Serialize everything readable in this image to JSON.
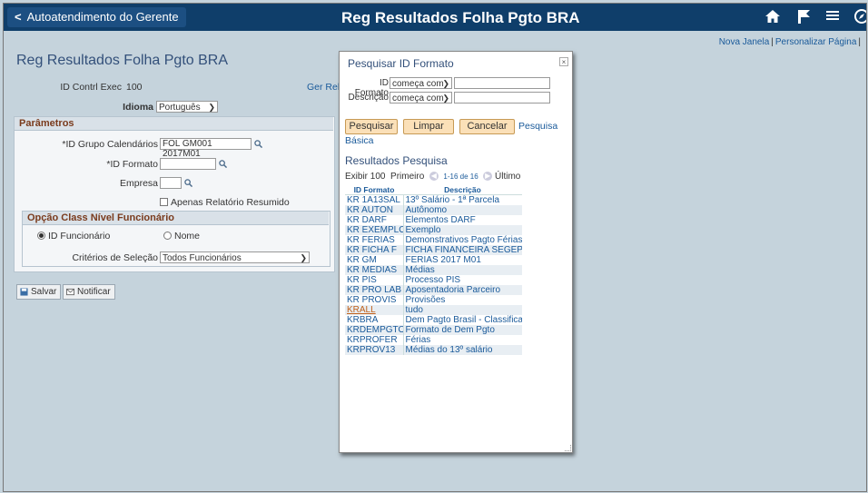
{
  "topbar": {
    "back_label": "Autoatendimento do Gerente",
    "title": "Reg Resultados Folha Pgto BRA",
    "icons": [
      "home-icon",
      "flag-icon",
      "menu-icon",
      "compass-icon"
    ]
  },
  "links": {
    "new_window": "Nova Janela",
    "sep": "|",
    "personalize": "Personalizar Página"
  },
  "page": {
    "title": "Reg Resultados Folha Pgto BRA",
    "run_control_label": "ID Contrl Exec",
    "run_control_value": "100",
    "ger_link": "Ger Rela",
    "language_label": "Idioma",
    "language_value": "Português"
  },
  "parametros": {
    "header": "Parâmetros",
    "calendar_group_label": "*ID Grupo Calendários",
    "calendar_group_value": "FOL GM001 2017M01",
    "format_id_label": "*ID Formato",
    "format_id_value": "",
    "company_label": "Empresa",
    "company_value": "",
    "summary_only_label": "Apenas Relatório Resumido",
    "summary_only_checked": false
  },
  "opcao": {
    "header": "Opção Class Nível Funcionário",
    "radio_id_label": "ID Funcionário",
    "radio_name_label": "Nome",
    "selected": "ID Funcionário",
    "criteria_label": "Critérios de Seleção",
    "criteria_value": "Todos Funcionários"
  },
  "actions": {
    "save_label": "Salvar",
    "notify_label": "Notificar"
  },
  "modal": {
    "title": "Pesquisar ID Formato",
    "close": "×",
    "field1_label": "ID Formato",
    "field1_op": "começa com",
    "field1_value": "",
    "field2_label": "Descrição",
    "field2_op": "começa com",
    "field2_value": "",
    "search_btn": "Pesquisar",
    "clear_btn": "Limpar",
    "cancel_btn": "Cancelar",
    "basic_link_1": "Pesquisa",
    "basic_link_2": "Básica",
    "results_title": "Resultados Pesquisa",
    "pager_show": "Exibir 100",
    "pager_first": "Primeiro",
    "pager_count": "1-16 de 16",
    "pager_last": "Último",
    "col1": "ID Formato",
    "col2": "Descrição",
    "rows": [
      [
        "KR 1A13SAL",
        "13º Salário - 1ª Parcela"
      ],
      [
        "KR AUTON",
        "Autônomo"
      ],
      [
        "KR DARF",
        "Elementos DARF"
      ],
      [
        "KR EXEMPLO",
        "Exemplo"
      ],
      [
        "KR FERIAS",
        "Demonstrativos Pagto Férias"
      ],
      [
        "KR FICHA F",
        "FICHA FINANCEIRA SEGEP"
      ],
      [
        "KR GM",
        "FERIAS 2017 M01"
      ],
      [
        "KR MEDIAS",
        "Médias"
      ],
      [
        "KR PIS",
        "Processo PIS"
      ],
      [
        "KR PRO LAB",
        "Aposentadoria Parceiro"
      ],
      [
        "KR PROVIS",
        "Provisões"
      ],
      [
        "KRALL",
        "tudo"
      ],
      [
        "KRBRA",
        "Dem Pagto Brasil - Classificar"
      ],
      [
        "KRDEMPGTO",
        "Formato de Dem Pgto"
      ],
      [
        "KRPROFER",
        "Férias"
      ],
      [
        "KRPROV13",
        "Médias do 13º salário"
      ]
    ],
    "highlight_row": 11
  },
  "colors": {
    "topbar": "#0f3e6a",
    "background": "#c5d3dc",
    "link": "#1a5a9a",
    "section_header_text": "#7a3b1d",
    "button": "#fbe0b8"
  }
}
